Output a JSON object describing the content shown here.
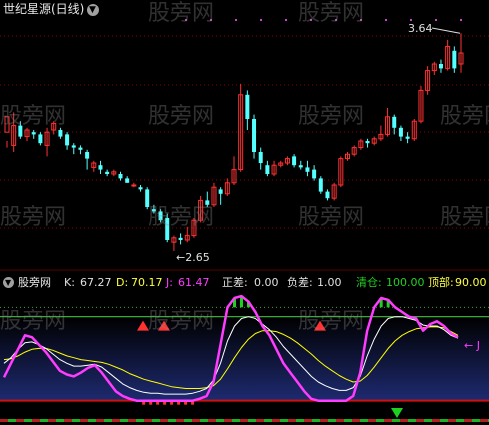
{
  "top_panel": {
    "title": "世纪星源(日线)",
    "collapse_icon": "circle-chevron-down-icon",
    "high_label": "3.64",
    "low_label": "2.65",
    "watermark": "股旁网"
  },
  "bottom_panel": {
    "indicator_name": "股旁网",
    "collapse_icon": "circle-chevron-down-icon",
    "k_label": "K:",
    "k_value": "67.27",
    "d_label": "D:",
    "d_value": "70.17",
    "j_label": "J:",
    "j_value": "61.47",
    "zhengcha_label": "正差:",
    "zhengcha_value": "0.00",
    "fucha_label": "负差:",
    "fucha_value": "1.00",
    "qingcang_label": "清仓:",
    "qingcang_value": "100.00",
    "dingbu_label": "顶部:",
    "dingbu_value": "90.00",
    "j_line_label": "J"
  },
  "colors": {
    "bg": "#000000",
    "up": "#ff3232",
    "down": "#54ffff",
    "grid": "#8b0000",
    "j_line": "#ff3cff",
    "k_line": "#ffffff",
    "d_line": "#ffff00",
    "ding_line": "#40c040",
    "zero_line": "#d01010",
    "qingcang_bars": "#20d020",
    "text": "#c0c0c0",
    "title_k": "#e0e0e0",
    "title_green": "#20d020",
    "title_yellow": "#ffff40"
  },
  "chart_data": [
    {
      "type": "candlestick",
      "title": "世纪星源(日线)",
      "ylim": [
        2.6,
        3.7
      ],
      "annotations": [
        {
          "text": "3.64",
          "x_index": 68,
          "value": 3.64
        },
        {
          "text": "2.65",
          "x_index": 25,
          "value": 2.65
        }
      ],
      "candles": [
        [
          3.19,
          3.26,
          3.15,
          3.12
        ],
        [
          3.13,
          3.22,
          3.28,
          3.1
        ],
        [
          3.22,
          3.17,
          3.24,
          3.16
        ],
        [
          3.17,
          3.2,
          3.21,
          3.15
        ],
        [
          3.19,
          3.18,
          3.2,
          3.16
        ],
        [
          3.18,
          3.14,
          3.19,
          3.13
        ],
        [
          3.13,
          3.19,
          3.21,
          3.08
        ],
        [
          3.2,
          3.23,
          3.24,
          3.18
        ],
        [
          3.2,
          3.17,
          3.21,
          3.16
        ],
        [
          3.18,
          3.13,
          3.19,
          3.11
        ],
        [
          3.13,
          3.12,
          3.14,
          3.09
        ],
        [
          3.12,
          3.11,
          3.13,
          3.09
        ],
        [
          3.1,
          3.07,
          3.11,
          3.02
        ],
        [
          3.03,
          3.05,
          3.06,
          3.01
        ],
        [
          3.04,
          3.02,
          3.06,
          3.0
        ],
        [
          3.01,
          3.0,
          3.02,
          2.99
        ],
        [
          3.0,
          3.01,
          3.02,
          2.99
        ],
        [
          3.0,
          2.98,
          3.01,
          2.97
        ],
        [
          2.98,
          2.96,
          2.99,
          2.96
        ],
        [
          2.95,
          2.95,
          2.96,
          2.94
        ],
        [
          2.94,
          2.93,
          2.95,
          2.92
        ],
        [
          2.93,
          2.85,
          2.94,
          2.84
        ],
        [
          2.84,
          2.83,
          2.86,
          2.82
        ],
        [
          2.83,
          2.79,
          2.84,
          2.78
        ],
        [
          2.8,
          2.7,
          2.82,
          2.69
        ],
        [
          2.69,
          2.71,
          2.72,
          2.65
        ],
        [
          2.71,
          2.7,
          2.73,
          2.68
        ],
        [
          2.7,
          2.72,
          2.76,
          2.69
        ],
        [
          2.72,
          2.79,
          2.8,
          2.71
        ],
        [
          2.79,
          2.88,
          2.9,
          2.78
        ],
        [
          2.88,
          2.86,
          2.92,
          2.85
        ],
        [
          2.86,
          2.94,
          2.96,
          2.85
        ],
        [
          2.93,
          2.91,
          2.94,
          2.86
        ],
        [
          2.91,
          2.96,
          2.98,
          2.9
        ],
        [
          2.96,
          3.02,
          3.08,
          2.95
        ],
        [
          3.02,
          3.36,
          3.41,
          3.01
        ],
        [
          3.36,
          3.25,
          3.38,
          3.2
        ],
        [
          3.25,
          3.1,
          3.27,
          3.07
        ],
        [
          3.1,
          3.05,
          3.12,
          3.02
        ],
        [
          3.04,
          3.0,
          3.06,
          2.99
        ],
        [
          3.0,
          3.04,
          3.06,
          2.99
        ],
        [
          3.04,
          3.05,
          3.06,
          3.03
        ],
        [
          3.05,
          3.07,
          3.08,
          3.04
        ],
        [
          3.08,
          3.04,
          3.09,
          3.03
        ],
        [
          3.04,
          3.03,
          3.06,
          3.02
        ],
        [
          3.03,
          3.01,
          3.06,
          2.99
        ],
        [
          3.02,
          2.98,
          3.04,
          2.97
        ],
        [
          2.98,
          2.92,
          2.99,
          2.91
        ],
        [
          2.92,
          2.89,
          2.93,
          2.88
        ],
        [
          2.89,
          2.95,
          2.96,
          2.88
        ],
        [
          2.95,
          3.07,
          3.08,
          2.94
        ],
        [
          3.07,
          3.09,
          3.1,
          3.06
        ],
        [
          3.09,
          3.12,
          3.13,
          3.08
        ],
        [
          3.12,
          3.15,
          3.16,
          3.11
        ],
        [
          3.15,
          3.14,
          3.16,
          3.12
        ],
        [
          3.14,
          3.16,
          3.17,
          3.13
        ],
        [
          3.16,
          3.18,
          3.22,
          3.15
        ],
        [
          3.18,
          3.26,
          3.3,
          3.17
        ],
        [
          3.26,
          3.21,
          3.27,
          3.18
        ],
        [
          3.21,
          3.17,
          3.22,
          3.15
        ],
        [
          3.17,
          3.16,
          3.19,
          3.14
        ],
        [
          3.16,
          3.24,
          3.25,
          3.15
        ],
        [
          3.24,
          3.38,
          3.4,
          3.23
        ],
        [
          3.38,
          3.47,
          3.49,
          3.36
        ],
        [
          3.47,
          3.5,
          3.51,
          3.45
        ],
        [
          3.5,
          3.48,
          3.52,
          3.46
        ],
        [
          3.48,
          3.58,
          3.61,
          3.47
        ],
        [
          3.56,
          3.48,
          3.58,
          3.46
        ],
        [
          3.5,
          3.55,
          3.64,
          3.46
        ]
      ]
    },
    {
      "type": "line",
      "title": "股旁网",
      "ylim": [
        -10,
        110
      ],
      "series": [
        {
          "name": "J",
          "values": [
            25,
            40,
            55,
            70,
            68,
            60,
            52,
            42,
            32,
            28,
            26,
            30,
            35,
            38,
            30,
            20,
            10,
            5,
            2,
            0,
            0,
            0,
            0,
            0,
            0,
            0,
            0,
            0,
            2,
            5,
            20,
            60,
            100,
            110,
            112,
            106,
            95,
            80,
            70,
            55,
            40,
            30,
            20,
            10,
            2,
            0,
            0,
            0,
            0,
            0,
            5,
            30,
            75,
            100,
            110,
            108,
            100,
            95,
            90,
            88,
            75,
            82,
            85,
            80,
            72,
            68
          ]
        },
        {
          "name": "K",
          "values": [
            40,
            46,
            55,
            62,
            63,
            60,
            56,
            50,
            44,
            40,
            37,
            37,
            38,
            39,
            36,
            30,
            24,
            18,
            14,
            11,
            9,
            8,
            8,
            7,
            7,
            7,
            7,
            8,
            10,
            13,
            22,
            40,
            64,
            80,
            88,
            90,
            88,
            82,
            76,
            68,
            58,
            50,
            42,
            34,
            26,
            20,
            16,
            13,
            11,
            11,
            14,
            26,
            48,
            66,
            80,
            88,
            90,
            90,
            88,
            86,
            81,
            80,
            80,
            76,
            70,
            67
          ]
        },
        {
          "name": "D",
          "values": [
            44,
            45,
            48,
            52,
            55,
            56,
            56,
            54,
            51,
            48,
            46,
            44,
            43,
            42,
            41,
            39,
            36,
            33,
            29,
            26,
            23,
            21,
            19,
            17,
            15,
            14,
            13,
            13,
            13,
            14,
            16,
            23,
            34,
            46,
            57,
            66,
            72,
            75,
            75,
            74,
            71,
            67,
            62,
            56,
            50,
            43,
            37,
            32,
            27,
            23,
            20,
            21,
            27,
            36,
            46,
            56,
            64,
            70,
            74,
            77,
            78,
            79,
            79,
            78,
            74,
            70
          ]
        }
      ],
      "reference_lines": [
        {
          "label": "顶部",
          "value": 90
        },
        {
          "label": "清仓",
          "value": 100
        },
        {
          "label": "正差",
          "value": 0
        }
      ]
    }
  ]
}
